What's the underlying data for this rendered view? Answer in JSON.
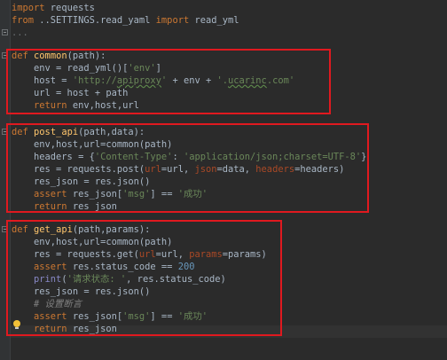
{
  "editor": {
    "language": "python",
    "colors": {
      "background": "#2b2b2b",
      "keyword": "#cc7832",
      "string": "#6a8759",
      "function": "#ffc66d",
      "highlight_box": "#e0191f"
    },
    "lines": {
      "l1": {
        "kw": "import",
        "rest": " requests"
      },
      "l2": {
        "kw1": "from",
        "mod": " ..SETTINGS.read_yaml ",
        "kw2": "import",
        "rest": " read_yml"
      },
      "l3": {
        "text": "..."
      },
      "common": {
        "def_kw": "def",
        "name": "common",
        "sig": "(path):",
        "env_a": "    env = read_yml()[",
        "env_str": "'env'",
        "env_b": "]",
        "host_a": "    host = ",
        "host_s1": "'http://",
        "host_s1b": "apiproxy",
        "host_s1c": "'",
        "host_mid": " + env + ",
        "host_s2a": "'.",
        "host_s2b": "ucarinc",
        "host_s2c": ".com'",
        "url": "    url = host + path",
        "ret_kw": "return",
        "ret_rest": " env,host,url"
      },
      "post_api": {
        "def_kw": "def",
        "name": "post_api",
        "sig": "(path,data):",
        "l1": "    env,host,url=common(path)",
        "hdr_a": "    headers = {",
        "hdr_s1": "'Content-Type'",
        "hdr_colon": ": ",
        "hdr_s2": "'application/json;charset=UTF-8'",
        "hdr_b": "}",
        "res_a": "    res = requests.post(",
        "res_p1": "url",
        "res_e1": "=url, ",
        "res_p2": "json",
        "res_e2": "=data, ",
        "res_p3": "headers",
        "res_e3": "=headers)",
        "json": "    res_json = res.json()",
        "assert_kw": "assert",
        "assert_a": " res_json[",
        "assert_s1": "'msg'",
        "assert_b": "] == ",
        "assert_s2": "'成功'",
        "ret_kw": "return",
        "ret_rest": " res_json"
      },
      "get_api": {
        "def_kw": "def",
        "name": "get_api",
        "sig": "(path,params):",
        "l1": "    env,host,url=common(path)",
        "res_a": "    res = requests.get(",
        "res_p1": "url",
        "res_e1": "=url, ",
        "res_p2": "params",
        "res_e2": "=params)",
        "assert1_kw": "assert",
        "assert1_rest": " res.status_code == ",
        "assert1_num": "200",
        "print_fn": "print",
        "print_a": "(",
        "print_s": "'请求状态: '",
        "print_b": ", res.status_code)",
        "json": "    res_json = res.json()",
        "comment": "# 设置断言",
        "assert2_kw": "assert",
        "assert2_a": " res_json[",
        "assert2_s1": "'msg'",
        "assert2_b": "] == ",
        "assert2_s2": "'成功'",
        "ret_kw": "return",
        "ret_rest": " res_json"
      }
    },
    "icons": [
      "fold-marker-icon",
      "lightbulb-icon"
    ]
  }
}
